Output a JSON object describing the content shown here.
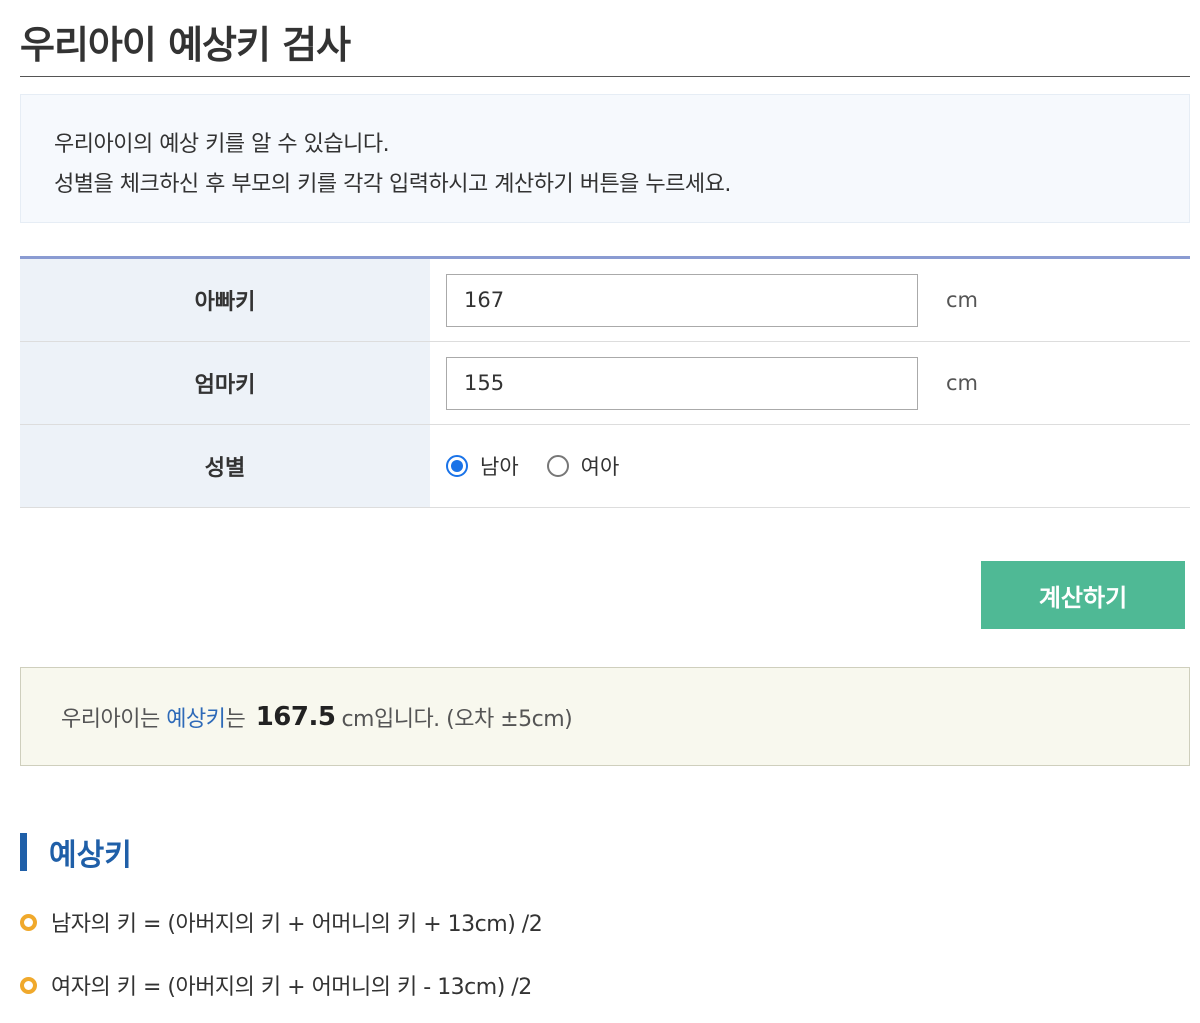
{
  "header": {
    "title": "우리아이 예상키 검사"
  },
  "info": {
    "line1": "우리아이의 예상 키를 알 수 있습니다.",
    "line2": "성별을 체크하신 후 부모의 키를 각각 입력하시고 계산하기 버튼을 누르세요."
  },
  "form": {
    "father_label": "아빠키",
    "father_value": "167",
    "mother_label": "엄마키",
    "mother_value": "155",
    "unit": "cm",
    "gender_label": "성별",
    "gender_options": [
      {
        "label": "남아",
        "selected": true
      },
      {
        "label": "여아",
        "selected": false
      }
    ]
  },
  "button": {
    "calc_label": "계산하기"
  },
  "result": {
    "prefix": "우리아이는",
    "highlight": "예상키",
    "suffix_particle": "는",
    "value": "167.5",
    "suffix": "cm입니다. (오차 ±5cm)"
  },
  "formulas": {
    "section_title": "예상키",
    "items": [
      "남자의 키 = (아버지의 키 + 어머니의 키 + 13cm) /2",
      "여자의 키 = (아버지의 키 + 어머니의 키 - 13cm) /2"
    ]
  },
  "colors": {
    "accent_green": "#4fb995",
    "accent_blue": "#1f5fa8",
    "radio_blue": "#1a73e8",
    "bullet_orange": "#f0a92c"
  }
}
